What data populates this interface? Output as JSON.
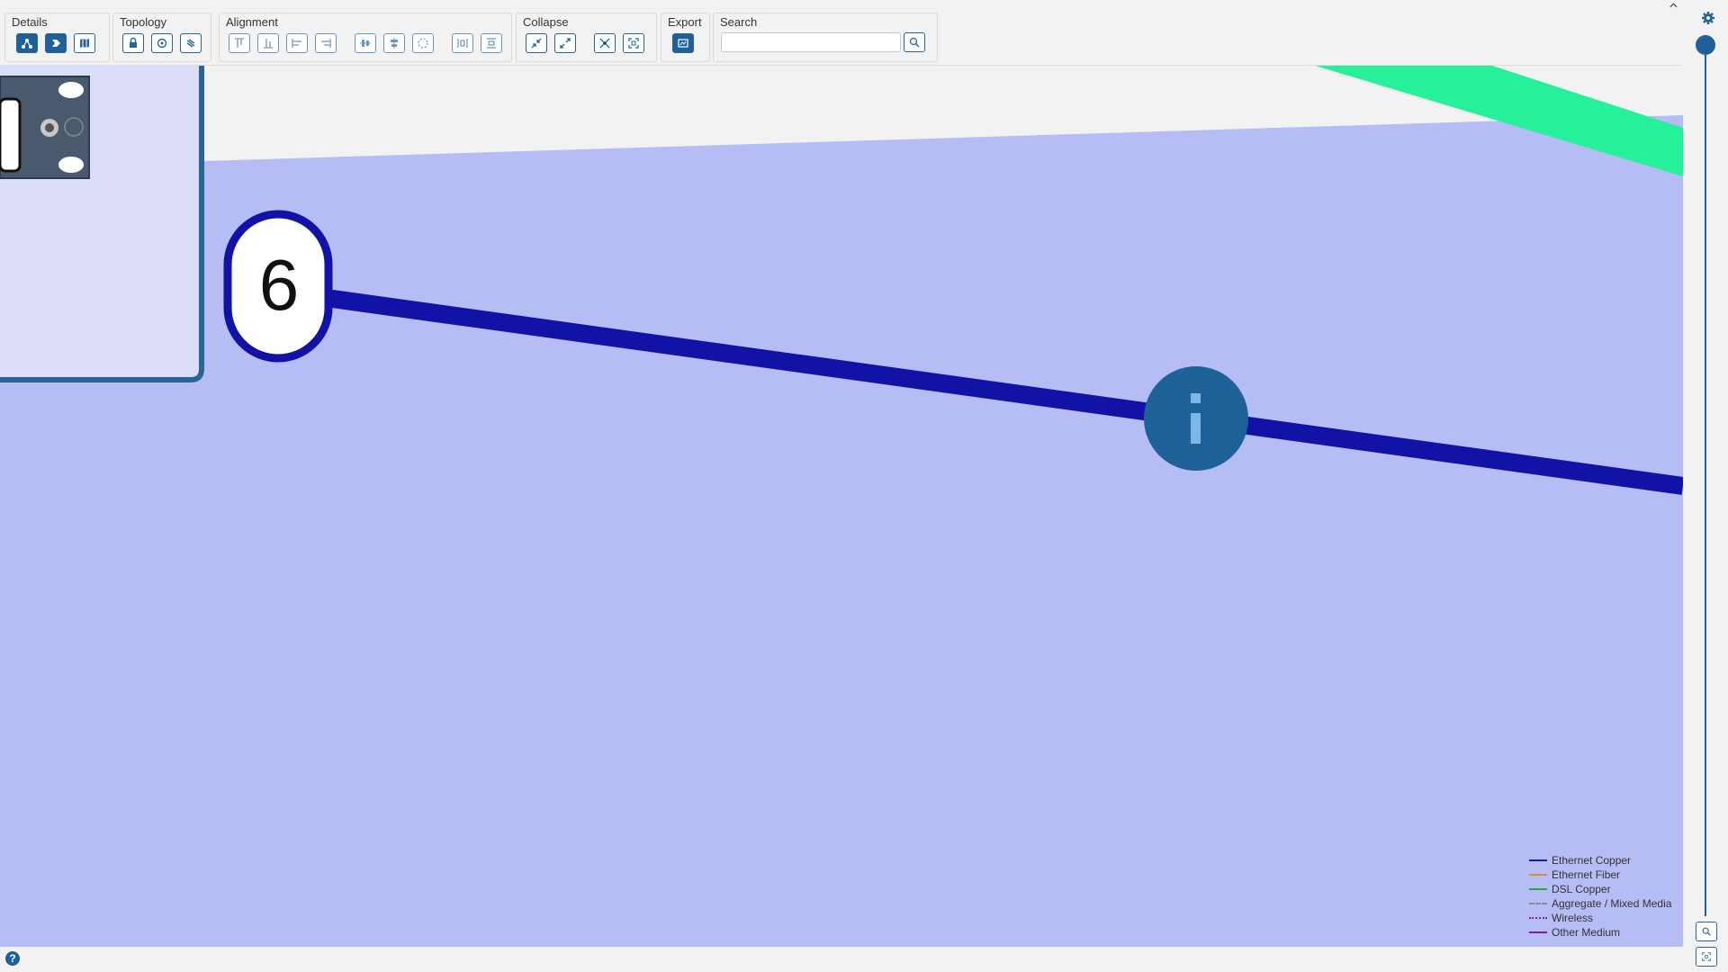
{
  "toolbar": {
    "groups": {
      "details": "Details",
      "topology": "Topology",
      "alignment": "Alignment",
      "collapse": "Collapse",
      "export": "Export",
      "search": "Search"
    },
    "search": {
      "value": "",
      "placeholder": ""
    },
    "collapse_caret": "^"
  },
  "canvas": {
    "node_label": "6",
    "info_icon": "info-icon"
  },
  "legend": [
    {
      "label": "Ethernet Copper",
      "color": "#1a1aa8",
      "style": "solid"
    },
    {
      "label": "Ethernet Fiber",
      "color": "#e08a3c",
      "style": "solid"
    },
    {
      "label": "DSL Copper",
      "color": "#2aa84a",
      "style": "solid"
    },
    {
      "label": "Aggregate / Mixed Media",
      "color": "#8a8a8a",
      "style": "dashed"
    },
    {
      "label": "Wireless",
      "color": "#7a1fa8",
      "style": "dotted"
    },
    {
      "label": "Other Medium",
      "color": "#7a1fa8",
      "style": "solid"
    }
  ],
  "help": "?",
  "colors": {
    "accent": "#1f5f9a",
    "zone_fill": "#b6bcf4",
    "link": "#1212a6",
    "green_link": "#27f09a"
  }
}
